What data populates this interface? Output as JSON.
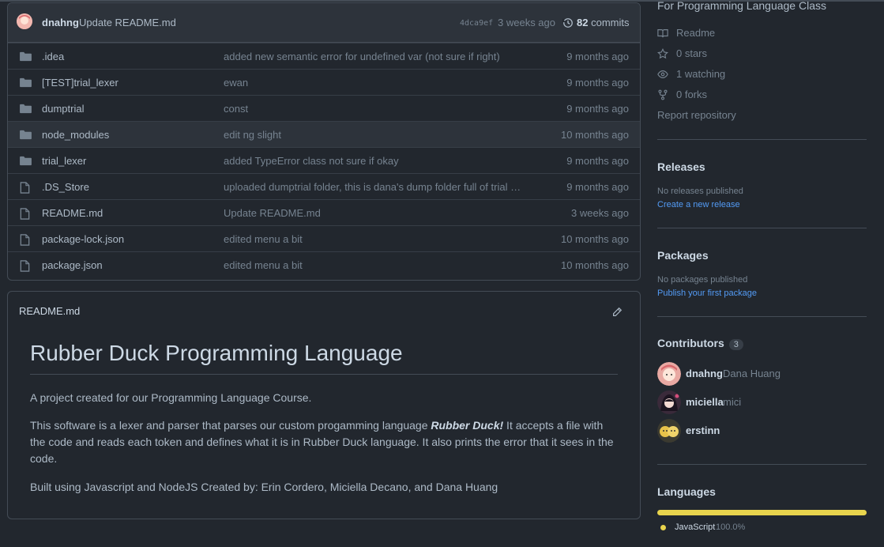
{
  "latest_commit": {
    "author": "dnahng",
    "message": "Update README.md",
    "sha": "4dca9ef",
    "time": "3 weeks ago",
    "commits_count": "82",
    "commits_label": "commits"
  },
  "files": [
    {
      "name": ".idea",
      "type": "folder",
      "message": "added new semantic error for undefined var (not sure if right)",
      "age": "9 months ago"
    },
    {
      "name": "[TEST]trial_lexer",
      "type": "folder",
      "message": "ewan",
      "age": "9 months ago"
    },
    {
      "name": "dumptrial",
      "type": "folder",
      "message": "const",
      "age": "9 months ago"
    },
    {
      "name": "node_modules",
      "type": "folder",
      "message": "edit ng slight",
      "age": "10 months ago"
    },
    {
      "name": "trial_lexer",
      "type": "folder",
      "message": "added TypeError class not sure if okay",
      "age": "9 months ago"
    },
    {
      "name": ".DS_Store",
      "type": "file",
      "message": "uploaded dumptrial folder, this is dana's dump folder full of trial a...",
      "age": "9 months ago"
    },
    {
      "name": "README.md",
      "type": "file",
      "message": "Update README.md",
      "age": "3 weeks ago"
    },
    {
      "name": "package-lock.json",
      "type": "file",
      "message": "edited menu a bit",
      "age": "10 months ago"
    },
    {
      "name": "package.json",
      "type": "file",
      "message": "edited menu a bit",
      "age": "10 months ago"
    }
  ],
  "readme": {
    "filename": "README.md",
    "title": "Rubber Duck Programming Language",
    "p1": "A project created for our Programming Language Course.",
    "p2_before": "This software is a lexer and parser that parses our custom progamming language ",
    "p2_bold": "Rubber Duck!",
    "p2_after": " It accepts a file with the code and reads each token and defines what it is in Rubber Duck language. It also prints the error that it sees in the code.",
    "p3": "Built using Javascript and NodeJS Created by: Erin Cordero, Miciella Decano, and Dana Huang"
  },
  "sidebar": {
    "about": "For Programming Language Class",
    "readme": "Readme",
    "stars": "0 stars",
    "watching": "1 watching",
    "forks": "0 forks",
    "report": "Report repository",
    "releases_title": "Releases",
    "releases_none": "No releases published",
    "releases_link": "Create a new release",
    "packages_title": "Packages",
    "packages_none": "No packages published",
    "packages_link": "Publish your first package",
    "contributors_title": "Contributors",
    "contributors_count": "3",
    "contributors": [
      {
        "login": "dnahng",
        "name": "Dana Huang"
      },
      {
        "login": "miciella",
        "name": "mici"
      },
      {
        "login": "erstinn",
        "name": ""
      }
    ],
    "languages_title": "Languages",
    "languages": [
      {
        "name": "JavaScript",
        "percent": "100.0%",
        "color": "#e8d44d"
      }
    ]
  }
}
